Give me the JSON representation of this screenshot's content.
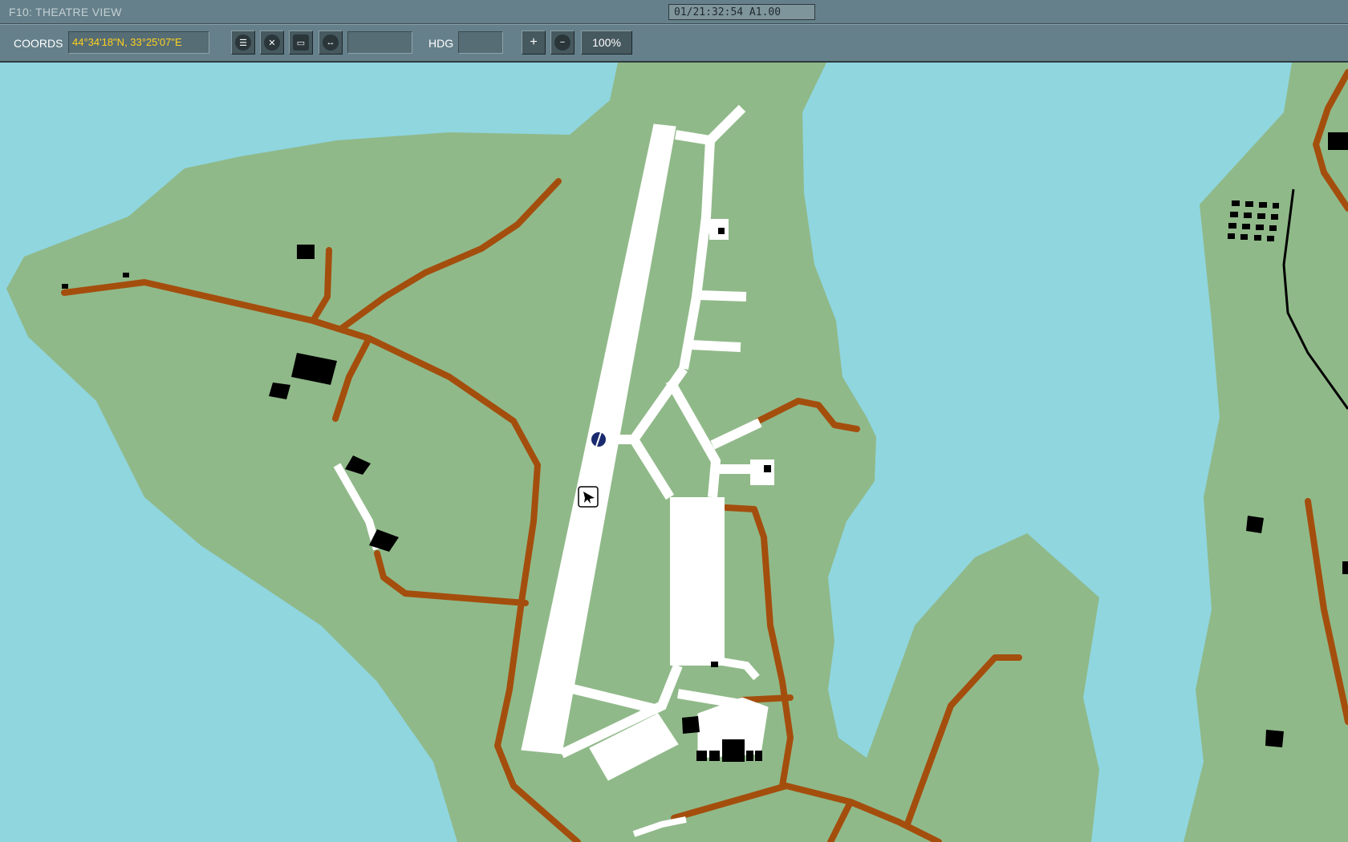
{
  "window": {
    "title": "F10: THEATRE VIEW",
    "clock": "01/21:32:54 A1.00"
  },
  "toolbar": {
    "coords_label": "COORDS",
    "coords_value": "44°34'18\"N, 33°25'07\"E",
    "measure_value": "",
    "hdg_label": "HDG",
    "hdg_value": "",
    "zoom_in": "+",
    "zoom_out": "−",
    "zoom_level": "100%",
    "tools": [
      {
        "name": "labels-icon",
        "glyph": "☰"
      },
      {
        "name": "ruler-off-icon",
        "glyph": "✕"
      },
      {
        "name": "comment-icon",
        "glyph": "💬"
      },
      {
        "name": "measure-icon",
        "glyph": "↔"
      }
    ]
  },
  "map": {
    "colors": {
      "water": "#8fd6df",
      "land": "#90b989",
      "road": "#a44e0d",
      "airfield": "#ffffff",
      "building": "#000000",
      "rail": "#000000"
    },
    "icons": [
      "airfield-beacon-icon",
      "aircraft-marker-icon"
    ]
  }
}
